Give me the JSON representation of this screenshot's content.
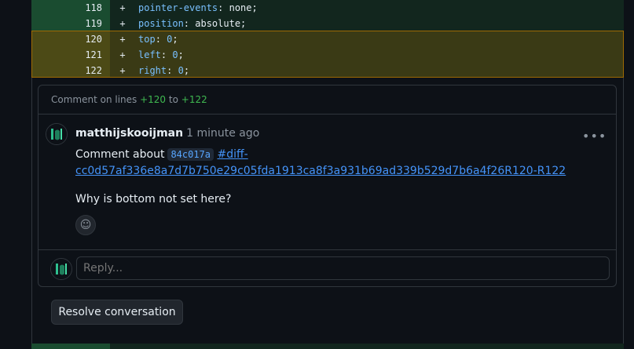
{
  "diff": {
    "lines": [
      {
        "num": "118",
        "sign": "+",
        "prop": "pointer-events",
        "value": "none",
        "value_type": "kw",
        "selected": false
      },
      {
        "num": "119",
        "sign": "+",
        "prop": "position",
        "value": "absolute",
        "value_type": "kw",
        "selected": false
      },
      {
        "num": "120",
        "sign": "+",
        "prop": "top",
        "value": "0",
        "value_type": "num",
        "selected": true
      },
      {
        "num": "121",
        "sign": "+",
        "prop": "left",
        "value": "0",
        "value_type": "num",
        "selected": true
      },
      {
        "num": "122",
        "sign": "+",
        "prop": "right",
        "value": "0",
        "value_type": "num",
        "selected": true
      }
    ]
  },
  "thread": {
    "header_prefix": "Comment on lines",
    "line_start": "+120",
    "to_word": "to",
    "line_end": "+122"
  },
  "comment": {
    "author": "matthijskooijman",
    "time": "1 minute ago",
    "more_icon": "kebab-horizontal-icon",
    "body_prefix": "Comment about",
    "sha": "84c017a",
    "link": "#diff-cc0d57af336e8a7d7b750e29c05fda1913ca8f3a931b69ad339b529d7b6a4f26R120-R122",
    "question": "Why is bottom not set here?",
    "reaction_icon": "smiley-icon"
  },
  "reply": {
    "placeholder": "Reply..."
  },
  "actions": {
    "resolve_label": "Resolve conversation"
  },
  "colors": {
    "added_bg": "#12261e",
    "added_num_bg": "#1a4c30",
    "selected_bg": "#3a3a15",
    "selected_border": "#9e6a03",
    "accent_link": "#4493f8",
    "line_ref_green": "#3fb950"
  }
}
